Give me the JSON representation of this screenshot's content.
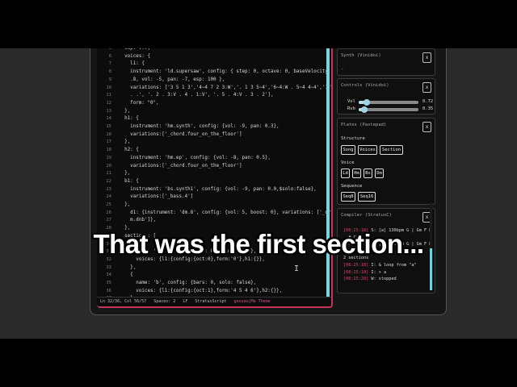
{
  "editor": {
    "line_numbers": [
      "5",
      "6",
      "7",
      "8",
      "9",
      "10",
      "11",
      "12",
      "13",
      "14",
      "15",
      "16",
      "17",
      "18",
      "19",
      "20",
      "21",
      "22",
      "23",
      "24",
      "25",
      "26",
      "27",
      "28",
      "29",
      "30",
      "31",
      "32",
      "33",
      "34",
      "35",
      "36",
      "37"
    ],
    "lines": [
      "  sup: ...,",
      "  voices: {",
      "    l1: {",
      "    instrument: 'ld.supersaw', config: { step: 0, octave: 0, baseVelocity: 0",
      "    .8, vol: -5, pan: -7, esp: 100 },",
      "    variations: ['3 5 1 3','4~4 7 2 3:W','. 1 3 5~4','6~4:W . 5~4 4~4','1:W .",
      "    . .', '. 2 . 3:V . 4 . 1:V', '. 5 . 4:V . 3 . 2'],",
      "    form: \"0\",",
      "  },",
      "  h1: {",
      "    instrument: 'hm.synth', config: {vol: -9, pan: 0.3},",
      "    variations:['_chord.four_on_the_floor']",
      "  },",
      "  h2: {",
      "    instrument: 'hm.ep', config: {vol: -8, pan: 0.5},",
      "    variations:['_chord.four_on_the_floor']",
      "  },",
      "  b1: {",
      "    instrument: 'bs.synth1', config: {vol: -9, pan: 0.0,$solo:false},",
      "    variations:['_bass.4']",
      "  },",
      "    d1: {instrument: 'dm.8', config: {vol: 5, boost: 0}, variations: ['_dru",
      "    m.dnb']},",
      "  },",
      "  sections: [",
      "    {",
      "      name: 'a', config: {bars: 8, solo: false},",
      "      voices: {l1:{config:{oct:0},form:'0'},h1:{}},",
      "    },",
      "    {",
      "      name: 'b', config: {bars: 0, solo: false},",
      "      voices: {l1:{config:{oct:1},form:'4 5 4 6'},h2:{}},",
      "    },"
    ],
    "status": {
      "position": "Ln 32/36, Col 56/57",
      "spaces": "Spaces: 2",
      "eol": "LF",
      "language": "StratusScript",
      "theme": "gesuaujMe Theme"
    }
  },
  "synth_panel": {
    "title": "Synth (Vinidoi)",
    "dash": "-",
    "close": "x"
  },
  "controls_panel": {
    "title": "Controls (Vinidoi)",
    "close": "x",
    "sliders": [
      {
        "label": "Vol",
        "value_text": "0.72",
        "level": 0.13
      },
      {
        "label": "Rvb",
        "value_text": "0.35",
        "level": 0.1
      }
    ]
  },
  "plates_panel": {
    "title": "Plates (Pastepad)",
    "close": "x",
    "structure_label": "Structure",
    "structure_buttons": [
      "Song",
      "Voices",
      "Section"
    ],
    "voice_label": "Voice",
    "voice_buttons": [
      "Ld",
      "Hm",
      "Bs",
      "Dm"
    ],
    "sequence_label": "Sequence",
    "sequence_buttons": [
      "Seq8",
      "Seq16"
    ]
  },
  "compiler_panel": {
    "title": "Compiler (StratusC)",
    "close": "x",
    "log": [
      {
        "ts": "[08:25:18]",
        "text": " S: [a] 130bpm G | Gm F D"
      },
      {
        "ts": "",
        "text": "  # Cm"
      },
      {
        "ts": "[08:25:18]",
        "text": " S: [b] 130bpm G | Gm F D"
      },
      {
        "ts": "",
        "text": "  # Cm"
      },
      {
        "ts": "",
        "text": "2 sections"
      },
      {
        "ts": "[08:25:18]",
        "text": " I: & loop from \"a\""
      },
      {
        "ts": "[08:25:18]",
        "text": " I: > a"
      },
      {
        "ts": "[08:25:28]",
        "text": " W: stopped"
      }
    ]
  },
  "caption": "That was the first section..."
}
